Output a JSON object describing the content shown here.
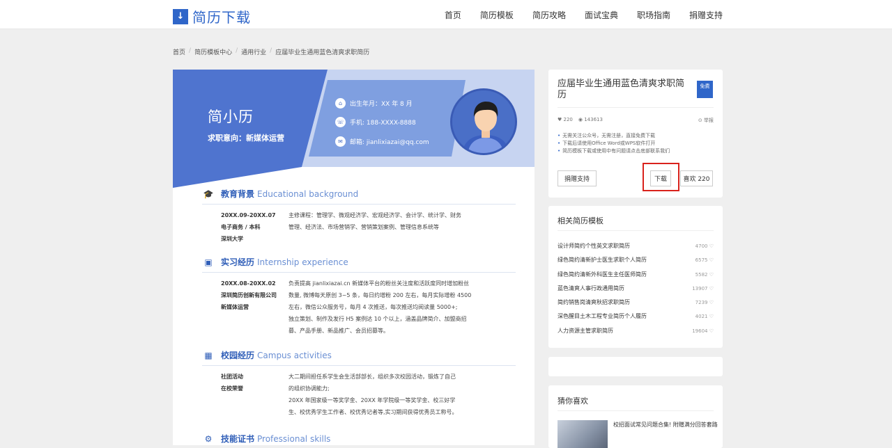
{
  "header": {
    "logo_icon": "download-icon",
    "logo_text": "简历下载",
    "nav": [
      "首页",
      "简历模板",
      "简历攻略",
      "面试宝典",
      "职场指南",
      "捐赠支持"
    ]
  },
  "breadcrumb": [
    "首页",
    "简历模板中心",
    "通用行业",
    "应届毕业生通用蓝色清爽求职简历"
  ],
  "resume": {
    "name": "简小历",
    "intent": "求职意向：新媒体运营",
    "birth": "出生年月：XX 年 8 月",
    "phone": "手机: 188-XXXX-8888",
    "email": "邮箱: jianlixiazai@qq.com",
    "edu": {
      "title": "教育背景",
      "title_en": "Educational background",
      "left": [
        "20XX.09-20XX.07",
        "电子商务 / 本科",
        "深圳大学"
      ],
      "right": [
        "主修课程：管理学、微观经济学、宏观经济学、会计学、统计学、财务",
        "管理、经济法、市场营销学、营销策划案例、管理信息系统等"
      ]
    },
    "intern": {
      "title": "实习经历",
      "title_en": "Internship experience",
      "left": [
        "20XX.08-20XX.02",
        "深圳简历创新有限公司",
        "新媒体运营"
      ],
      "right": [
        "负责提高 jianlixiazai.cn 新媒体平台的粉丝关注度和活跃度同时增加粉丝",
        "数量, 微博每天原创 3~5 条，每日约增粉 200 左右，每月实际增粉 4500",
        "左右，微信公众服务号，每月 4 次推送，每次推送均阅读量 5000+;",
        "独立策划、制作及发行 H5 案例达 10 个以上，涵盖品牌简介、加盟商招",
        "募、产品手册、新品推广、会员招募等。"
      ]
    },
    "campus": {
      "title": "校园经历",
      "title_en": "Campus activities",
      "left": [
        "社团活动",
        "在校荣誉"
      ],
      "right": [
        "大二期间担任系学生会生活部部长，组织多次校园活动，锻炼了自己",
        "的组织协调能力;",
        "20XX 年国家级一等奖学金、20XX 年学院级一等奖学金、校三好学",
        "生、校优秀学生工作者、校优秀记者等,实习期间获得优秀员工称号。"
      ]
    },
    "skills": {
      "title": "技能证书",
      "title_en": "Professional skills"
    }
  },
  "template_card": {
    "title": "应届毕业生通用蓝色清爽求职简历",
    "badge": "免费",
    "likes": "♥ 220",
    "views": "◉ 143613",
    "report": "⊙ 举报",
    "notes": [
      "无需关注公众号，无需注册，直接免费下载",
      "下载后请使用Office Word或WPS软件打开",
      "简历模板下载或使用中有问题请点击底部联系我们"
    ],
    "donate_label": "捐赠支持",
    "download_label": "下载",
    "like_label": "喜欢 220"
  },
  "related": {
    "title": "相关简历模板",
    "items": [
      {
        "name": "设计师简约个性英文求职简历",
        "count": "4700 ♡"
      },
      {
        "name": "绿色简约清新护士医生求职个人简历",
        "count": "6575 ♡"
      },
      {
        "name": "绿色简约清新外科医生主任医师简历",
        "count": "5582 ♡"
      },
      {
        "name": "蓝色清爽人事行政通用简历",
        "count": "13907 ♡"
      },
      {
        "name": "简约销售岗清爽秋招求职简历",
        "count": "7239 ♡"
      },
      {
        "name": "深色醒目土木工程专业简历个人履历",
        "count": "4021 ♡"
      },
      {
        "name": "人力资源主管求职简历",
        "count": "19604 ♡"
      }
    ]
  },
  "guess": {
    "title": "猜你喜欢",
    "article": "校招面试常见问题合集! 附赠满分回答套路"
  },
  "colors": {
    "brand": "#2f66c9",
    "highlight": "#d9221c"
  }
}
